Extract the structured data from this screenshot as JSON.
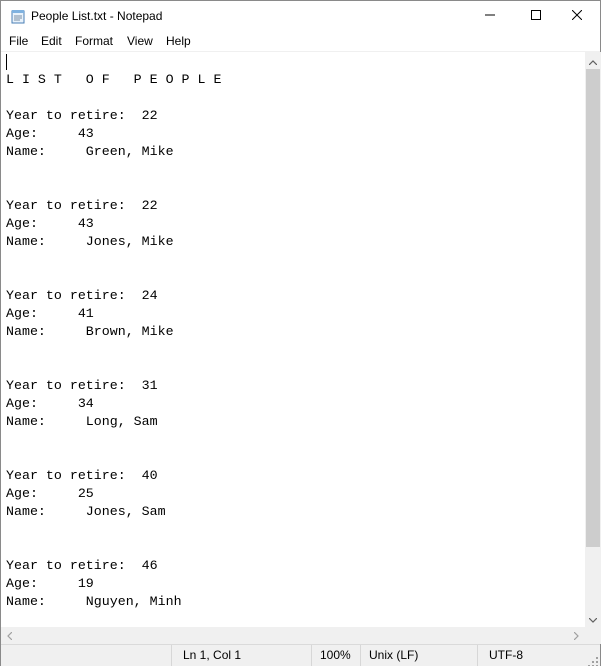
{
  "window": {
    "title": "People List.txt - Notepad"
  },
  "menu": {
    "items": [
      "File",
      "Edit",
      "Format",
      "View",
      "Help"
    ]
  },
  "editor": {
    "lines": [
      "L I S T   O F   P E O P L E",
      "",
      "Year to retire:  22",
      "Age:     43",
      "Name:     Green, Mike",
      "",
      "",
      "Year to retire:  22",
      "Age:     43",
      "Name:     Jones, Mike",
      "",
      "",
      "Year to retire:  24",
      "Age:     41",
      "Name:     Brown, Mike",
      "",
      "",
      "Year to retire:  31",
      "Age:     34",
      "Name:     Long, Sam",
      "",
      "",
      "Year to retire:  40",
      "Age:     25",
      "Name:     Jones, Sam",
      "",
      "",
      "Year to retire:  46",
      "Age:     19",
      "Name:     Nguyen, Minh"
    ]
  },
  "status": {
    "position": "Ln 1, Col 1",
    "zoom": "100%",
    "line_ending": "Unix (LF)",
    "encoding": "UTF-8"
  },
  "icons": {
    "app": "notepad-icon",
    "minimize": "minimize-icon",
    "maximize": "maximize-icon",
    "close": "close-icon"
  }
}
